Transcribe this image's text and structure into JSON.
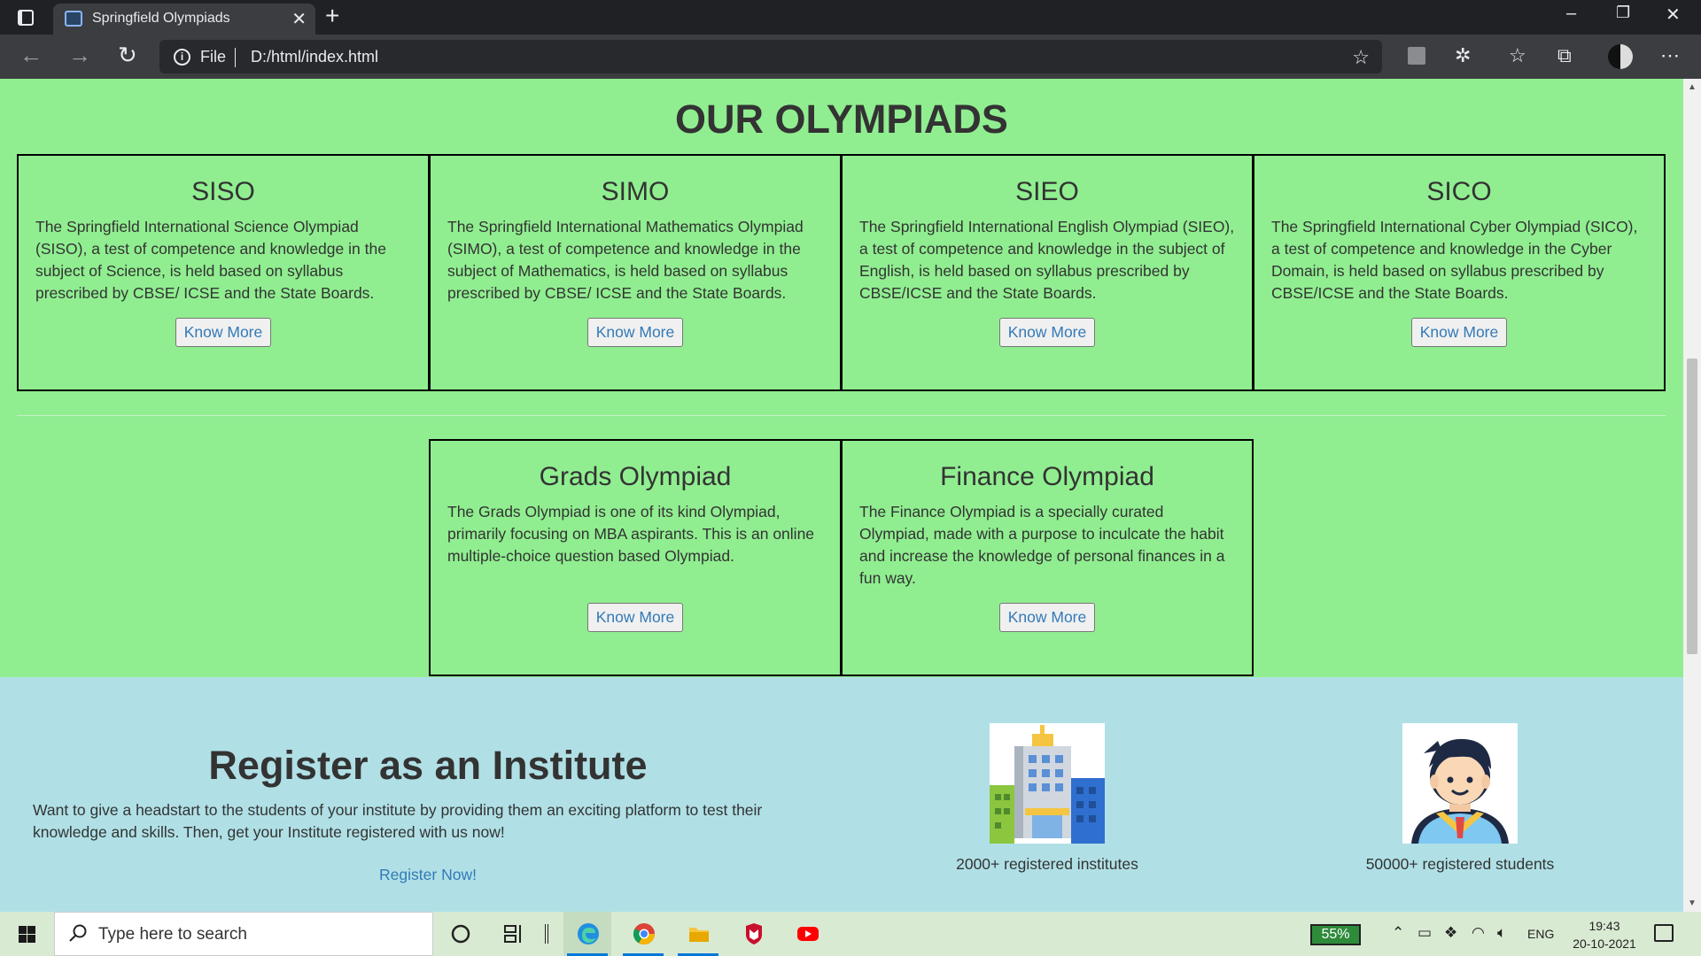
{
  "browser": {
    "tab_title": "Springfield Olympiads",
    "tab_close": "✕",
    "new_tab": "+",
    "omnibox_scheme": "File",
    "omnibox_url": "D:/html/index.html",
    "window_controls": {
      "minimize": "–",
      "restore": "❐",
      "close": "✕"
    }
  },
  "olympiads": {
    "title": "OUR OLYMPIADS",
    "button_label": "Know More",
    "cards": [
      {
        "name": "SISO",
        "description": "The Springfield International Science Olympiad (SISO), a test of competence and knowledge in the subject of Science, is held based on syllabus prescribed by CBSE/ ICSE and the State Boards."
      },
      {
        "name": "SIMO",
        "description": "The Springfield International Mathematics Olympiad (SIMO), a test of competence and knowledge in the subject of Mathematics, is held based on syllabus prescribed by CBSE/ ICSE and the State Boards."
      },
      {
        "name": "SIEO",
        "description": "The Springfield International English Olympiad (SIEO), a test of competence and knowledge in the subject of English, is held based on syllabus prescribed by CBSE/ICSE and the State Boards."
      },
      {
        "name": "SICO",
        "description": "The Springfield International Cyber Olympiad (SICO), a test of competence and knowledge in the Cyber Domain, is held based on syllabus prescribed by CBSE/ICSE and the State Boards."
      },
      {
        "name": "Grads Olympiad",
        "description": "The Grads Olympiad is one of its kind Olympiad, primarily focusing on MBA aspirants. This is an online multiple-choice question based Olympiad."
      },
      {
        "name": "Finance Olympiad",
        "description": "The Finance Olympiad is a specially curated Olympiad, made with a purpose to inculcate the habit and increase the knowledge of personal finances in a fun way."
      }
    ]
  },
  "register": {
    "title": "Register as an Institute",
    "text": "Want to give a headstart to the students of your institute by providing them an exciting platform to test their knowledge and skills. Then, get your Institute registered with us now!",
    "link": "Register Now!",
    "stats": [
      {
        "label": "2000+ registered institutes",
        "icon": "building-icon"
      },
      {
        "label": "50000+ registered students",
        "icon": "student-icon"
      }
    ]
  },
  "taskbar": {
    "search_placeholder": "Type here to search",
    "battery_percent": "55%",
    "language": "ENG",
    "time": "19:43",
    "date": "20-10-2021"
  },
  "colors": {
    "olympiad_bg": "#90ee90",
    "register_bg": "#b0e0e6",
    "link": "#337ab7",
    "browser_dark": "#202124",
    "taskbar_bg": "#d9ead3"
  }
}
